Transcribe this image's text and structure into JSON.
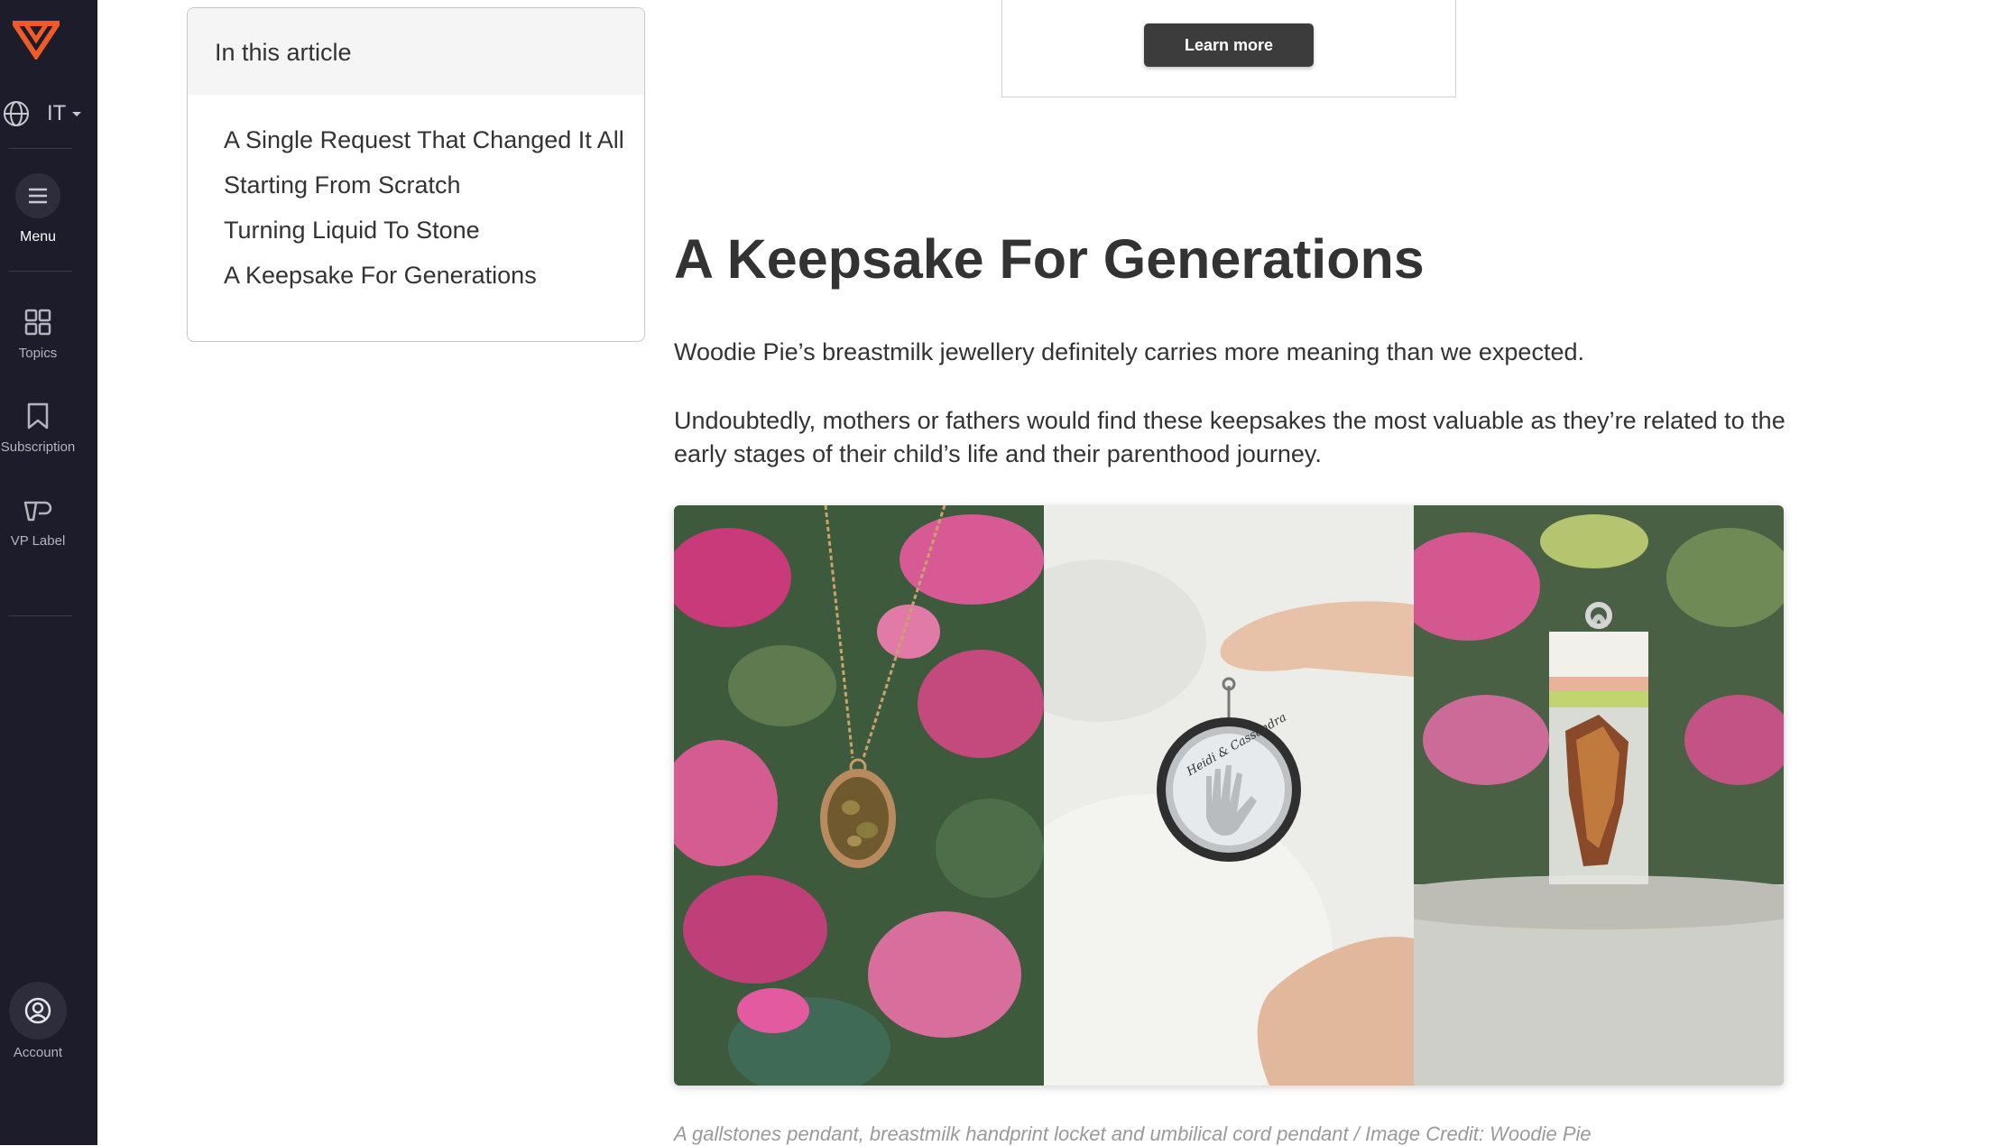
{
  "sidebar": {
    "language": "IT",
    "menu_label": "Menu",
    "topics_label": "Topics",
    "subscription_label": "Subscription",
    "vp_label": "VP Label",
    "account_label": "Account"
  },
  "toc": {
    "heading": "In this article",
    "items": [
      "A Single Request That Changed It All",
      "Starting From Scratch",
      "Turning Liquid To Stone",
      "A Keepsake For Generations"
    ]
  },
  "ad": {
    "button_label": "Learn more"
  },
  "article": {
    "title": "A Keepsake For Generations",
    "paragraph1": "Woodie Pie’s breastmilk jewellery definitely carries more meaning than we expected.",
    "paragraph2": "Undoubtedly, mothers or fathers would find these keepsakes the most valuable as they’re related to the early stages of their child’s life and their parenthood journey.",
    "image_caption": "A gallstones pendant, breastmilk handprint locket and umbilical cord pendant / Image Credit: Woodie Pie",
    "locket_engraving": "Heidi & Cassandra"
  },
  "colors": {
    "sidebar_bg": "#1c1c2a",
    "brand_orange": "#f05a28",
    "button_dark": "#3c3c3c"
  }
}
